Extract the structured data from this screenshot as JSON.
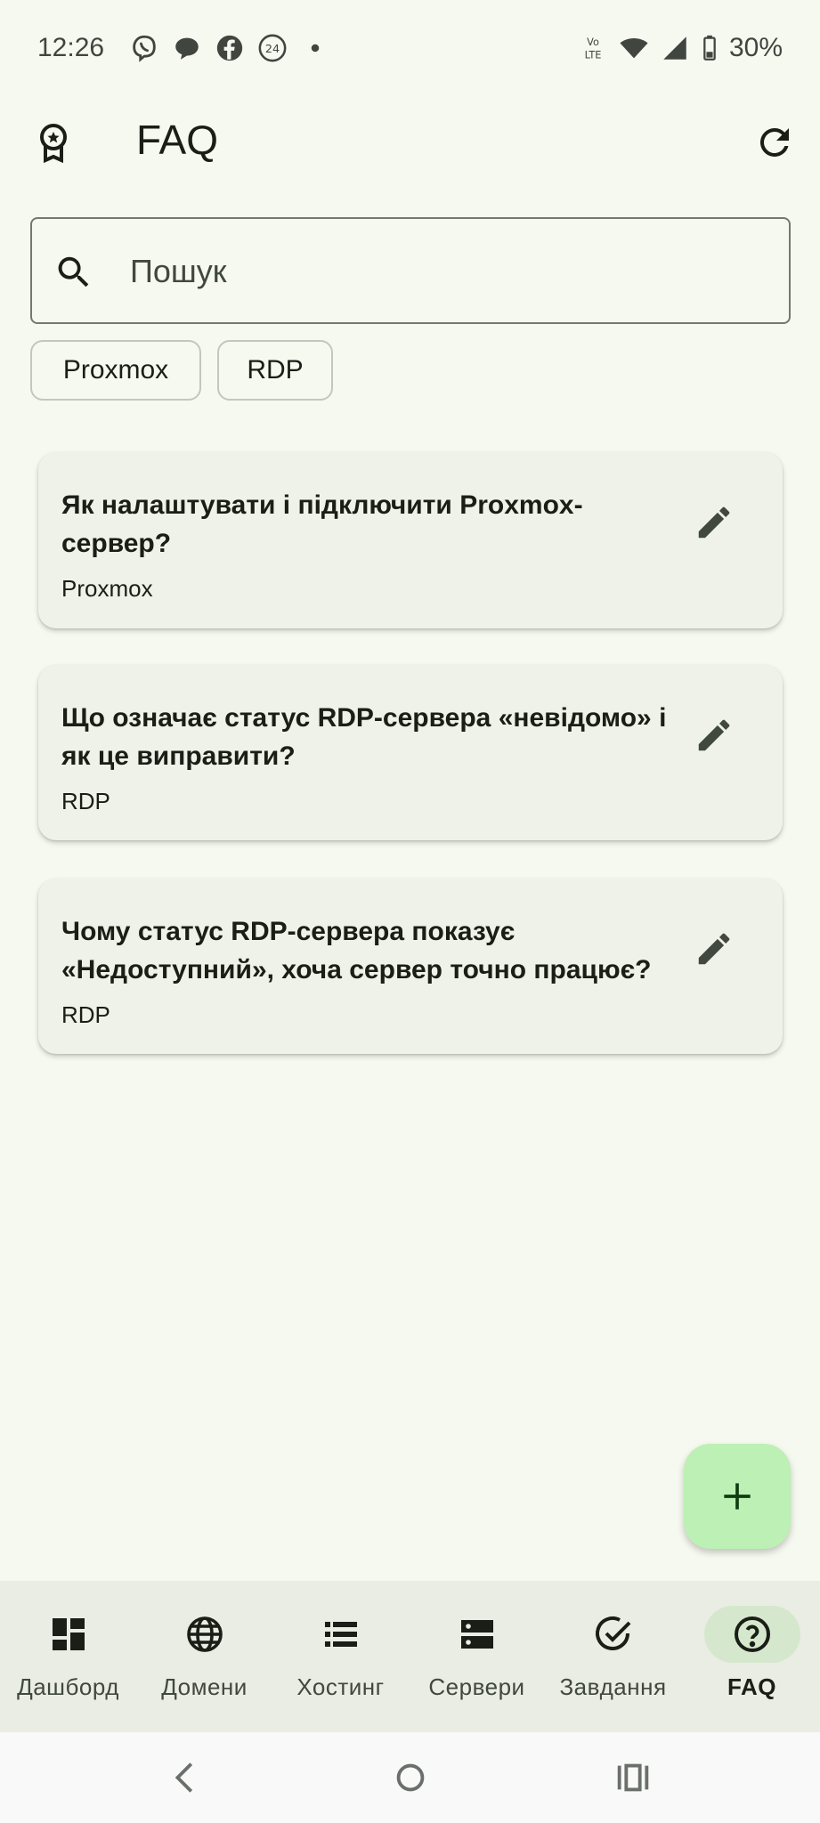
{
  "status_bar": {
    "time": "12:26",
    "battery": "30%",
    "icons": [
      "viber-icon",
      "chat-bubble-icon",
      "facebook-icon",
      "news24-icon",
      "dot-icon",
      "volte-icon",
      "wifi-icon",
      "signal-icon",
      "battery-icon"
    ]
  },
  "app_bar": {
    "title": "FAQ",
    "logo_icon": "award-badge-icon",
    "refresh_icon": "refresh-icon"
  },
  "search": {
    "placeholder": "Пошук",
    "icon": "search-icon"
  },
  "filters": [
    {
      "label": "Proxmox"
    },
    {
      "label": "RDP"
    }
  ],
  "faq_items": [
    {
      "question": "Як налаштувати і підключити Proxmox-сервер?",
      "tag": "Proxmox",
      "action_icon": "edit-icon"
    },
    {
      "question": "Що означає статус RDP-сервера «невідомо» і як це виправити?",
      "tag": "RDP",
      "action_icon": "edit-icon"
    },
    {
      "question": "Чому статус RDP-сервера показує «Недоступний», хоча сервер точно працює?",
      "tag": "RDP",
      "action_icon": "edit-icon"
    }
  ],
  "fab": {
    "icon": "plus-icon"
  },
  "bottom_nav": {
    "items": [
      {
        "label": "Дашборд",
        "icon": "dashboard-icon"
      },
      {
        "label": "Домени",
        "icon": "globe-icon"
      },
      {
        "label": "Хостинг",
        "icon": "list-icon"
      },
      {
        "label": "Сервери",
        "icon": "server-icon"
      },
      {
        "label": "Завдання",
        "icon": "task-check-icon"
      },
      {
        "label": "FAQ",
        "icon": "help-circle-icon",
        "active": true
      }
    ]
  },
  "system_nav": [
    "back-icon",
    "home-icon",
    "recents-icon"
  ],
  "colors": {
    "background": "#f6f9f0",
    "card": "#eff2e8",
    "fab": "#bdf0b4",
    "nav_active": "#d5e8cd",
    "text": "#1b1d17"
  }
}
